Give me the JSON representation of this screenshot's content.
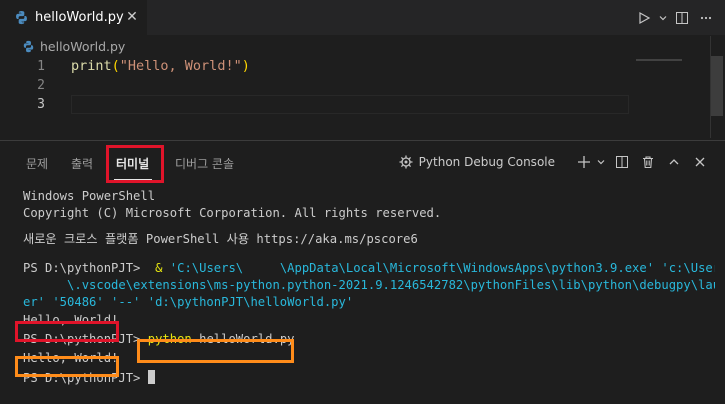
{
  "tab": {
    "filename": "helloWorld.py",
    "close_glyph": "✕"
  },
  "toolbar": {
    "run_icon": "play-icon",
    "dropdown_icon": "chevron-down-icon",
    "split_icon": "split-editor-icon",
    "more_icon": "more-icon"
  },
  "breadcrumb": {
    "filename": "helloWorld.py"
  },
  "editor": {
    "line_numbers": [
      "1",
      "2",
      "3"
    ],
    "code": {
      "fn": "print",
      "open": "(",
      "str": "\"Hello, World!\"",
      "close": ")"
    }
  },
  "panel": {
    "tabs": [
      "문제",
      "출력",
      "터미널",
      "디버그 콘솔"
    ],
    "active_tab": "터미널",
    "console_name": "Python Debug Console",
    "icons": [
      "add-terminal-icon",
      "chevron-down-icon",
      "split-terminal-icon",
      "trash-icon",
      "maximize-icon",
      "close-icon"
    ]
  },
  "terminal": {
    "lines": [
      "Windows PowerShell",
      "Copyright (C) Microsoft Corporation. All rights reserved.",
      "새로운 크로스 플랫폼 PowerShell 사용 https://aka.ms/pscore6"
    ],
    "cmd1": {
      "prompt": "PS D:\\pythonPJT> ",
      "amp": " & ",
      "exe": "'C:\\Users\\     \\AppData\\Local\\Microsoft\\WindowsApps\\python3.9.exe'",
      "arg1_start": " 'c:\\Users\\",
      "wrap1": "      \\.vscode\\extensions\\ms-python.python-2021.9.1246542782\\pythonFiles\\lib\\python\\debugpy\\launch",
      "wrap2": "er' '50486' '--' 'd:\\pythonPJT\\helloWorld.py'"
    },
    "output1": "Hello, World!",
    "cmd2": {
      "prompt": "PS D:\\pythonPJT> ",
      "command": "python",
      "arg": " helloWorld.py"
    },
    "output2": "Hello, World!",
    "prompt3": "PS D:\\pythonPJT> "
  },
  "colors": {
    "highlight_red": "#e0142a",
    "highlight_orange": "#ff8c1a",
    "background": "#1e1e1e"
  }
}
